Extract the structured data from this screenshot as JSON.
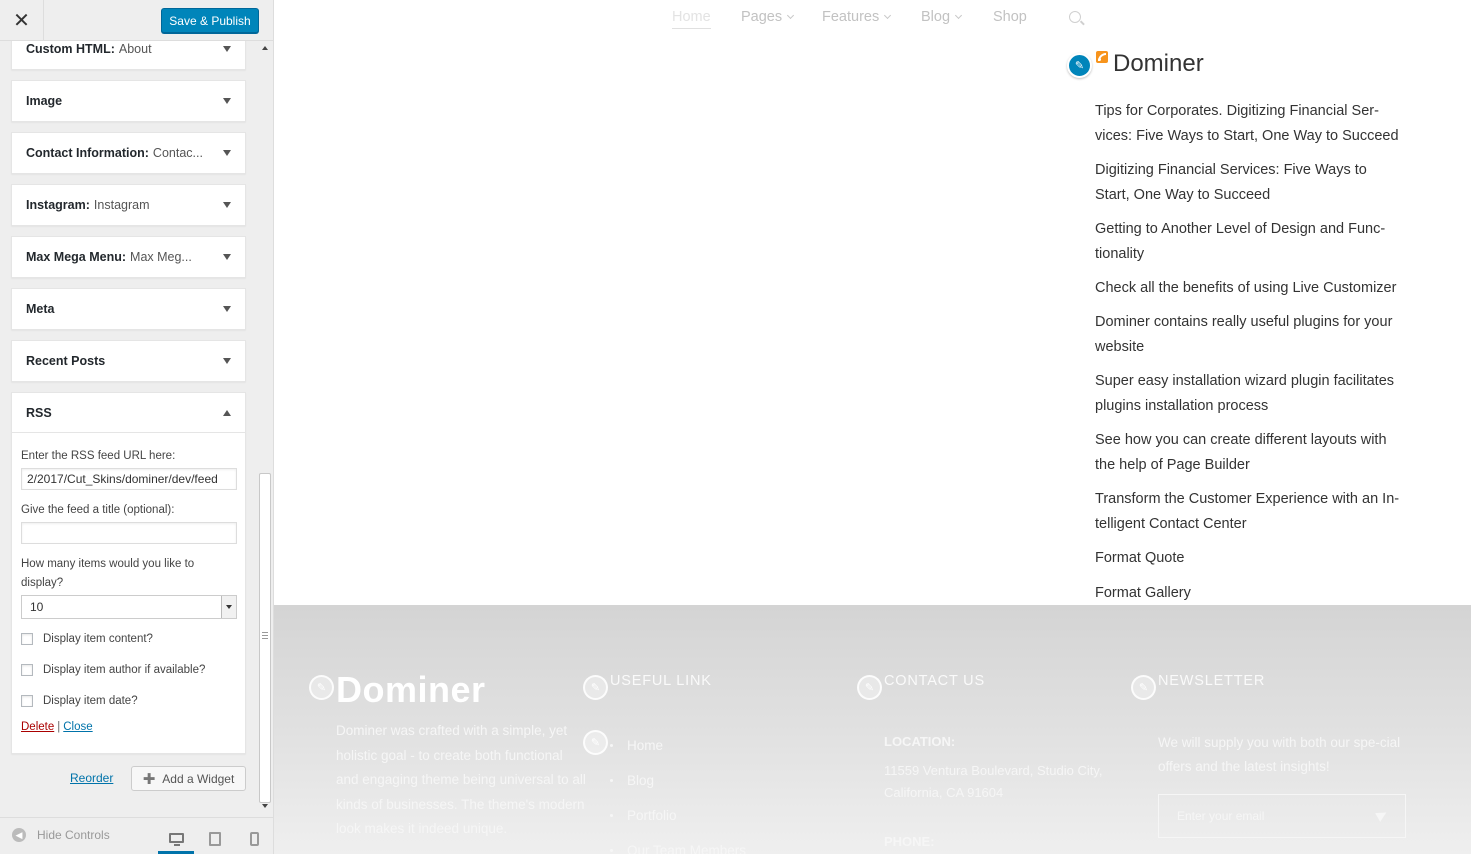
{
  "header": {
    "close_symbol": "✕",
    "save_label": "Save & Publish"
  },
  "widgets": [
    {
      "name": "Custom HTML",
      "title": "About",
      "expanded": false
    },
    {
      "name": "Image",
      "title": "",
      "expanded": false
    },
    {
      "name": "Contact Information",
      "title": "Contac...",
      "expanded": false
    },
    {
      "name": "Instagram",
      "title": "Instagram",
      "expanded": false
    },
    {
      "name": "Max Mega Menu",
      "title": "Max Meg...",
      "expanded": false
    },
    {
      "name": "Meta",
      "title": "",
      "expanded": false
    },
    {
      "name": "Recent Posts",
      "title": "",
      "expanded": false
    },
    {
      "name": "RSS",
      "title": "",
      "expanded": true
    }
  ],
  "rss_form": {
    "url_label": "Enter the RSS feed URL here:",
    "url_value": "2/2017/Cut_Skins/dominer/dev/feed",
    "title_label": "Give the feed a title (optional):",
    "title_value": "",
    "items_label": "How many items would you like to display?",
    "items_value": "10",
    "checkboxes": [
      {
        "label": "Display item content?",
        "checked": false
      },
      {
        "label": "Display item author if available?",
        "checked": false
      },
      {
        "label": "Display item date?",
        "checked": false
      }
    ],
    "delete_label": "Delete",
    "separator": "|",
    "close_label": "Close"
  },
  "actions": {
    "reorder_label": "Reorder",
    "add_widget_label": "Add a Widget"
  },
  "footer_controls": {
    "hide_controls_label": "Hide Controls",
    "active_device": "desktop"
  },
  "preview": {
    "nav": {
      "items": [
        {
          "label": "Home",
          "has_dropdown": false,
          "active": true
        },
        {
          "label": "Pages",
          "has_dropdown": true,
          "active": false
        },
        {
          "label": "Features",
          "has_dropdown": true,
          "active": false
        },
        {
          "label": "Blog",
          "has_dropdown": true,
          "active": false
        },
        {
          "label": "Shop",
          "has_dropdown": false,
          "active": false
        }
      ],
      "search_icon": "search-icon"
    },
    "rss_widget": {
      "title": "Dominer",
      "items": [
        "Tips for Corporates. Digitizing Financial Ser-vices: Five Ways to Start, One Way to Succeed",
        "Digitizing Financial Services: Five Ways to Start, One Way to Succeed",
        "Getting to Another Level of Design and Func-tionality",
        "Check all the benefits of using Live Customizer",
        "Dominer contains really useful plugins for your website",
        "Super easy installation wizard plugin facilitates plugins installation process",
        "See how you can create different layouts with the help of Page Builder",
        "Transform the Customer Experience with an In-telligent Contact Center",
        "Format Quote",
        "Format Gallery"
      ]
    },
    "footer": {
      "logo": "Dominer",
      "about": "Dominer was crafted with a simple, yet holistic goal - to create both functional and engaging theme being universal to all kinds of businesses. The theme's modern look makes it indeed unique.",
      "useful_link_title": "USEFUL LINK",
      "links": [
        "Home",
        "Blog",
        "Portfolio",
        "Our Team Members"
      ],
      "contact_title": "CONTACT US",
      "location_label": "LOCATION:",
      "location_value": "11559 Ventura Boulevard, Studio City, California, CA 91604",
      "phone_label": "PHONE:",
      "newsletter_title": "NEWSLETTER",
      "newsletter_text": "We will supply you with both our spe-cial offers and the latest insights!",
      "email_placeholder": "Enter your email"
    }
  },
  "colors": {
    "primary_button": "#0085ba",
    "link": "#0073aa",
    "delete_link": "#aa0000",
    "footer_bg": "#d8d8d8"
  }
}
